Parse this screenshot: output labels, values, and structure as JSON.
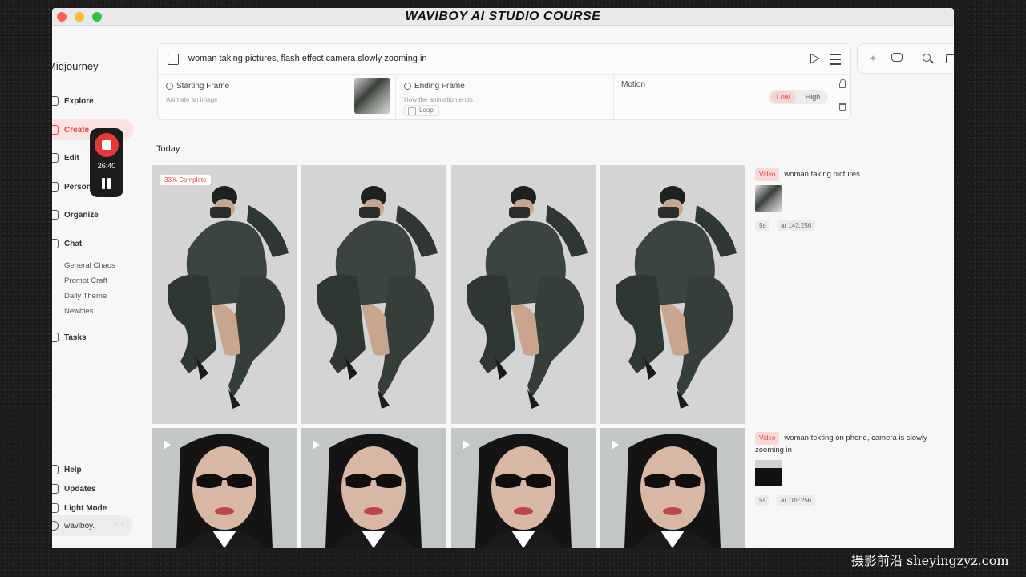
{
  "window": {
    "course_title": "WAVIBOY AI STUDIO COURSE"
  },
  "sidebar": {
    "brand": "Midjourney",
    "items": [
      {
        "label": "Explore",
        "icon": "compass-icon"
      },
      {
        "label": "Create",
        "icon": "brush-icon",
        "active": true
      },
      {
        "label": "Edit",
        "icon": "edit-icon"
      },
      {
        "label": "Personalize",
        "icon": "person-icon"
      },
      {
        "label": "Organize",
        "icon": "folder-icon"
      },
      {
        "label": "Chat",
        "icon": "chat-icon"
      }
    ],
    "chat_rooms": [
      "General Chaos",
      "Prompt Craft",
      "Daily Theme",
      "Newbies"
    ],
    "tasks": "Tasks",
    "bottom_items": [
      "Help",
      "Updates",
      "Light Mode"
    ],
    "user": "waviboy.",
    "user_menu": "···"
  },
  "recorder": {
    "time": "26:40",
    "accent": "#e53935"
  },
  "prompt": {
    "text": "woman taking pictures, flash effect camera slowly zooming in",
    "starting_frame": {
      "title": "Starting Frame",
      "subtitle": "Animate an image"
    },
    "ending_frame": {
      "title": "Ending Frame",
      "subtitle": "How the animation ends",
      "loop": "Loop"
    },
    "motion": {
      "title": "Motion",
      "low": "Low",
      "high": "High",
      "selected": "Low"
    }
  },
  "gallery": {
    "section": "Today",
    "jobs": [
      {
        "badge": "33% Complete",
        "progress_percent": 33,
        "tag": "Video",
        "prompt": "woman taking pictures",
        "duration": "5s",
        "aspect": "ar 143:256"
      },
      {
        "tag": "Video",
        "prompt": "woman texting on phone, camera is slowly zooming in",
        "duration": "5s",
        "aspect": "ar 189:256"
      }
    ]
  },
  "watermark": "摄影前沿 sheyingzyz.com",
  "colors": {
    "accent": "#e04848",
    "accent_bg": "#fde2e2"
  }
}
